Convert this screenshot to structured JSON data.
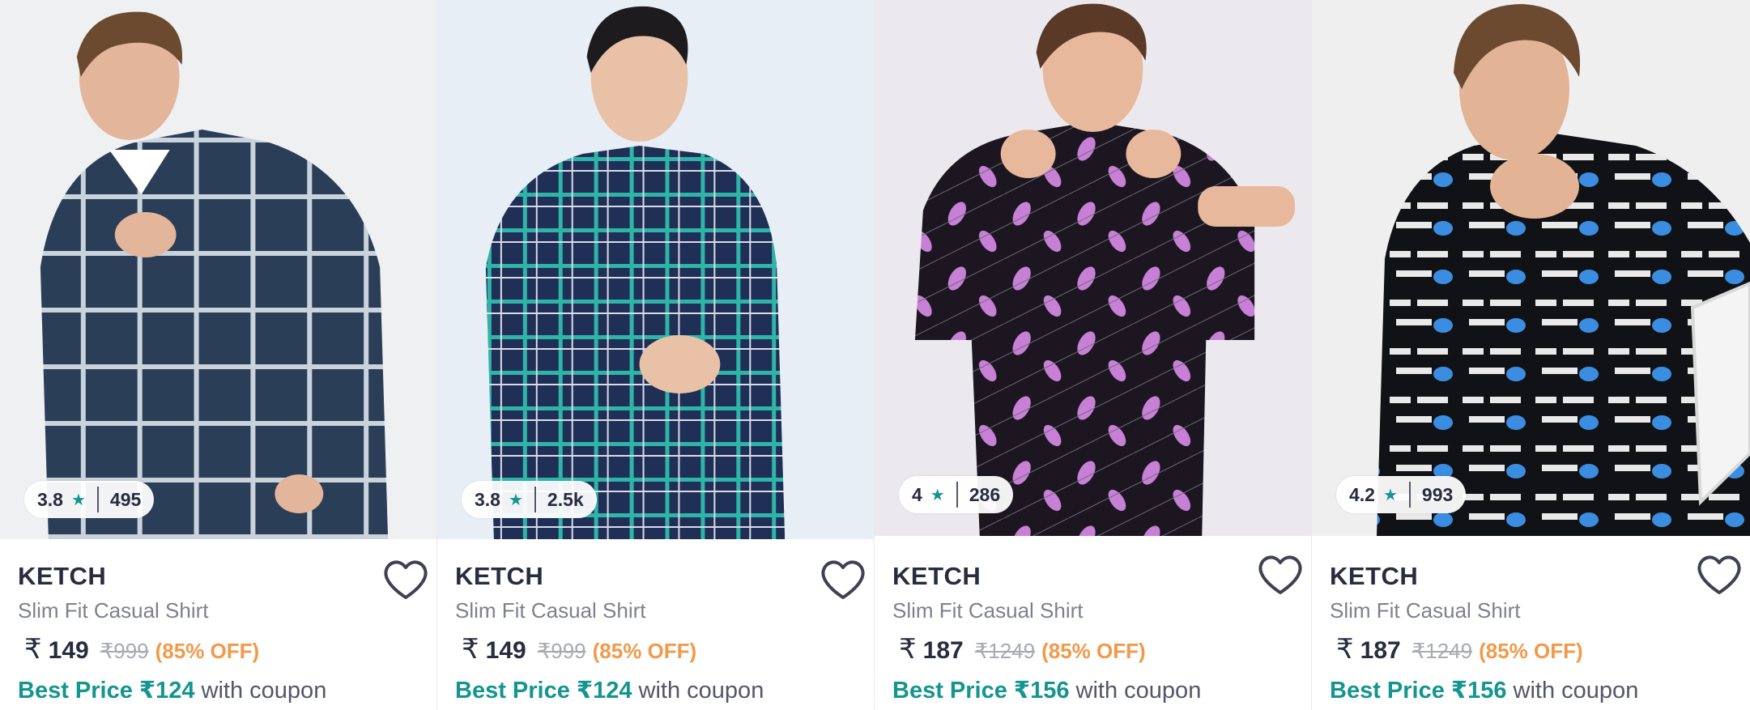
{
  "products": [
    {
      "rating": "3.8",
      "rating_count": "495",
      "brand": "KETCH",
      "title": "Slim Fit Casual Shirt",
      "currency": "₹",
      "price": "149",
      "mrp": "₹999",
      "discount": "(85% OFF)",
      "best_price_label": "Best Price ₹124",
      "coupon_text": "with coupon",
      "shirt_color": "#2b3e57",
      "pattern_color": "#c9d3dc",
      "bg_color": "#eef0f2"
    },
    {
      "rating": "3.8",
      "rating_count": "2.5k",
      "brand": "KETCH",
      "title": "Slim Fit Casual Shirt",
      "currency": "₹",
      "price": "149",
      "mrp": "₹999",
      "discount": "(85% OFF)",
      "best_price_label": "Best Price ₹124",
      "coupon_text": "with coupon",
      "shirt_color": "#1f2f55",
      "pattern_color": "#2fb5a8",
      "bg_color": "#e8eef6"
    },
    {
      "rating": "4",
      "rating_count": "286",
      "brand": "KETCH",
      "title": "Slim Fit Casual Shirt",
      "currency": "₹",
      "price": "187",
      "mrp": "₹1249",
      "discount": "(85% OFF)",
      "best_price_label": "Best Price ₹156",
      "coupon_text": "with coupon",
      "shirt_color": "#1b1620",
      "pattern_color": "#c780d6",
      "bg_color": "#ebe9ee"
    },
    {
      "rating": "4.2",
      "rating_count": "993",
      "brand": "KETCH",
      "title": "Slim Fit Casual Shirt",
      "currency": "₹",
      "price": "187",
      "mrp": "₹1249",
      "discount": "(85% OFF)",
      "best_price_label": "Best Price ₹156",
      "coupon_text": "with coupon",
      "shirt_color": "#111216",
      "pattern_color": "#3a8de0",
      "bg_color": "#efefef"
    }
  ],
  "icons": {
    "rating_star": "star-icon",
    "wishlist": "heart-outline-icon"
  },
  "colors": {
    "accent_teal": "#14958f",
    "discount_orange": "#f2994a",
    "text_dark": "#282c3f",
    "text_muted": "#7e818c"
  }
}
